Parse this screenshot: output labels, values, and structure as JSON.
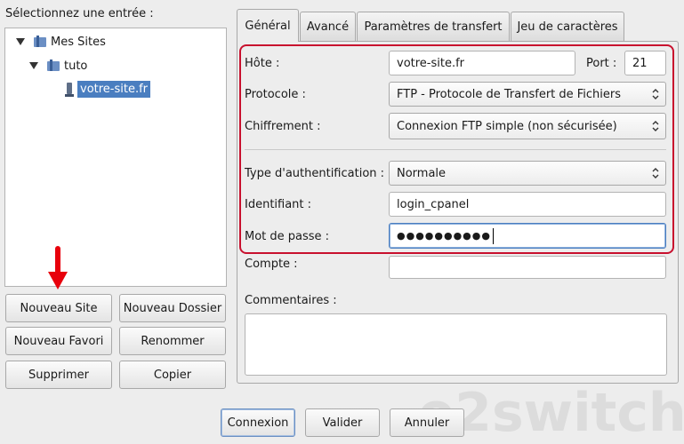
{
  "left_panel": {
    "heading": "Sélectionnez une entrée :",
    "tree": {
      "root": "Mes Sites",
      "folder": "tuto",
      "site": "votre-site.fr"
    },
    "buttons": {
      "new_site": "Nouveau Site",
      "new_folder": "Nouveau Dossier",
      "new_bookmark": "Nouveau Favori",
      "rename": "Renommer",
      "delete": "Supprimer",
      "copy": "Copier"
    }
  },
  "tabs": [
    "Général",
    "Avancé",
    "Paramètres de transfert",
    "Jeu de caractères"
  ],
  "form": {
    "host_label": "Hôte :",
    "host_value": "votre-site.fr",
    "port_label": "Port :",
    "port_value": "21",
    "protocol_label": "Protocole :",
    "protocol_value": "FTP - Protocole de Transfert de Fichiers",
    "encryption_label": "Chiffrement :",
    "encryption_value": "Connexion FTP simple (non sécurisée)",
    "auth_label": "Type d'authentification :",
    "auth_value": "Normale",
    "user_label": "Identifiant :",
    "user_value": "login_cpanel",
    "password_label": "Mot de passe :",
    "password_value": "●●●●●●●●●●",
    "account_label": "Compte :",
    "account_value": "",
    "comments_label": "Commentaires :",
    "comments_value": ""
  },
  "bottom_buttons": {
    "connect": "Connexion",
    "ok": "Valider",
    "cancel": "Annuler"
  },
  "watermark": "o2switch",
  "colors": {
    "selection": "#4a7ec0",
    "highlight_border": "#c8102e",
    "arrow": "#e8000c"
  }
}
